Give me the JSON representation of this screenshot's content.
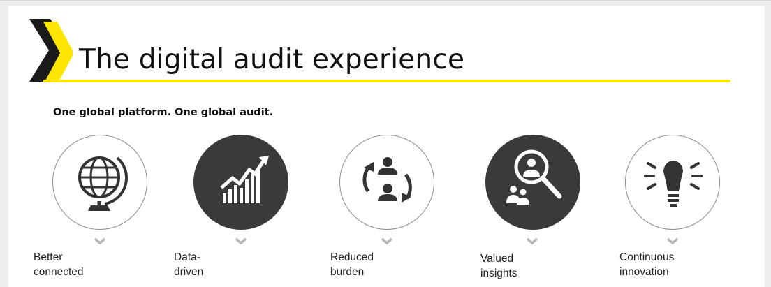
{
  "title": "The digital audit experience",
  "subtitle": "One global platform. One global audit.",
  "colors": {
    "accent": "#ffe600",
    "dark": "#3a3a3a",
    "text": "#111111"
  },
  "items": [
    {
      "line1": "Better",
      "line2": "connected",
      "icon": "globe-icon",
      "style": "light"
    },
    {
      "line1": "Data-",
      "line2": "driven",
      "icon": "rising-chart-icon",
      "style": "dark"
    },
    {
      "line1": "Reduced",
      "line2": "burden",
      "icon": "people-exchange-icon",
      "style": "light"
    },
    {
      "line1": "Valued",
      "line2": "insights",
      "icon": "magnifier-people-icon",
      "style": "dark"
    },
    {
      "line1": "Continuous",
      "line2": "innovation",
      "icon": "lightbulb-icon",
      "style": "light"
    }
  ]
}
